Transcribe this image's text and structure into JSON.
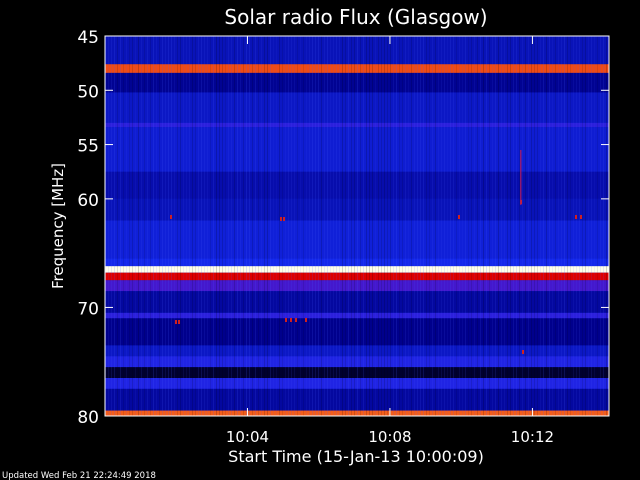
{
  "chart_data": {
    "type": "heatmap",
    "title": "Solar radio Flux (Glasgow)",
    "xlabel": "Start Time (15-Jan-13 10:00:09)",
    "ylabel": "Frequency [MHz]",
    "xlim": [
      "10:00:09",
      "10:14:18"
    ],
    "ylim": [
      80,
      45
    ],
    "x_ticks": [
      "10:04",
      "10:08",
      "10:12"
    ],
    "x_tick_minutes": [
      240,
      480,
      720
    ],
    "x_span_minutes": 849,
    "y_ticks": [
      45,
      50,
      55,
      60,
      70,
      80
    ],
    "y_tick_pos": [
      45,
      50,
      55,
      60,
      70,
      80
    ],
    "colormap": "blue-red-white",
    "bands": [
      {
        "from": 45.0,
        "to": 47.6,
        "level": 0.22
      },
      {
        "from": 47.6,
        "to": 48.4,
        "level": 0.78
      },
      {
        "from": 48.4,
        "to": 50.2,
        "level": 0.16
      },
      {
        "from": 50.2,
        "to": 53.0,
        "level": 0.24
      },
      {
        "from": 53.0,
        "to": 53.4,
        "level": 0.34
      },
      {
        "from": 53.4,
        "to": 57.5,
        "level": 0.26
      },
      {
        "from": 57.5,
        "to": 60.0,
        "level": 0.2
      },
      {
        "from": 60.0,
        "to": 62.0,
        "level": 0.22
      },
      {
        "from": 62.0,
        "to": 65.5,
        "level": 0.27
      },
      {
        "from": 65.5,
        "to": 66.2,
        "level": 0.3
      },
      {
        "from": 66.2,
        "to": 66.8,
        "level": 1.0
      },
      {
        "from": 66.8,
        "to": 67.5,
        "level": 0.7
      },
      {
        "from": 67.5,
        "to": 68.5,
        "level": 0.38
      },
      {
        "from": 68.5,
        "to": 70.5,
        "level": 0.18
      },
      {
        "from": 70.5,
        "to": 71.0,
        "level": 0.34
      },
      {
        "from": 71.0,
        "to": 73.5,
        "level": 0.15
      },
      {
        "from": 73.5,
        "to": 74.5,
        "level": 0.24
      },
      {
        "from": 74.5,
        "to": 75.5,
        "level": 0.32
      },
      {
        "from": 75.5,
        "to": 76.5,
        "level": 0.05
      },
      {
        "from": 76.5,
        "to": 77.5,
        "level": 0.32
      },
      {
        "from": 77.5,
        "to": 79.5,
        "level": 0.18
      },
      {
        "from": 79.5,
        "to": 80.0,
        "level": 0.8
      }
    ]
  },
  "footer": "Updated Wed Feb 21 22:24:49 2018"
}
